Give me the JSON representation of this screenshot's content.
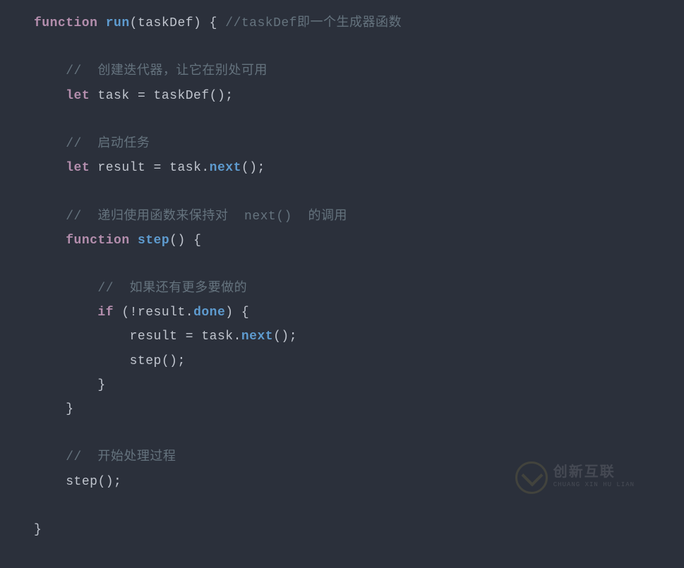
{
  "code": {
    "l1": {
      "kw": "function",
      "fn": "run",
      "params": "(taskDef)",
      "brace": " {",
      "cmt": " //taskDef即一个生成器函数"
    },
    "l3": {
      "cmt": "//  创建迭代器，让它在别处可用"
    },
    "l4": {
      "kw": "let",
      "id": " task ",
      "eq": "=",
      "call": " taskDef",
      "paren": "();"
    },
    "l6": {
      "cmt": "//  启动任务"
    },
    "l7": {
      "kw": "let",
      "id": " result ",
      "eq": "=",
      "obj": " task.",
      "fn": "next",
      "paren": "();"
    },
    "l9": {
      "cmt": "//  递归使用函数来保持对  next()  的调用"
    },
    "l10": {
      "kw": "function",
      "fn": " step",
      "paren": "()",
      "brace": " {"
    },
    "l12": {
      "cmt": "//  如果还有更多要做的"
    },
    "l13": {
      "kw": "if",
      "open": " (",
      "neg": "!",
      "obj": "result.",
      "prop": "done",
      "close": ")",
      "brace": " {"
    },
    "l14": {
      "lhs": "result ",
      "eq": "=",
      "obj": " task.",
      "fn": "next",
      "paren": "();"
    },
    "l15": {
      "fn": "step",
      "paren": "();"
    },
    "l16": {
      "brace": "}"
    },
    "l17": {
      "brace": "}"
    },
    "l19": {
      "cmt": "//  开始处理过程"
    },
    "l20": {
      "fn": "step",
      "paren": "();"
    },
    "l22": {
      "brace": "}"
    }
  },
  "watermark": {
    "title": "创新互联",
    "sub": "CHUANG XIN HU LIAN"
  }
}
